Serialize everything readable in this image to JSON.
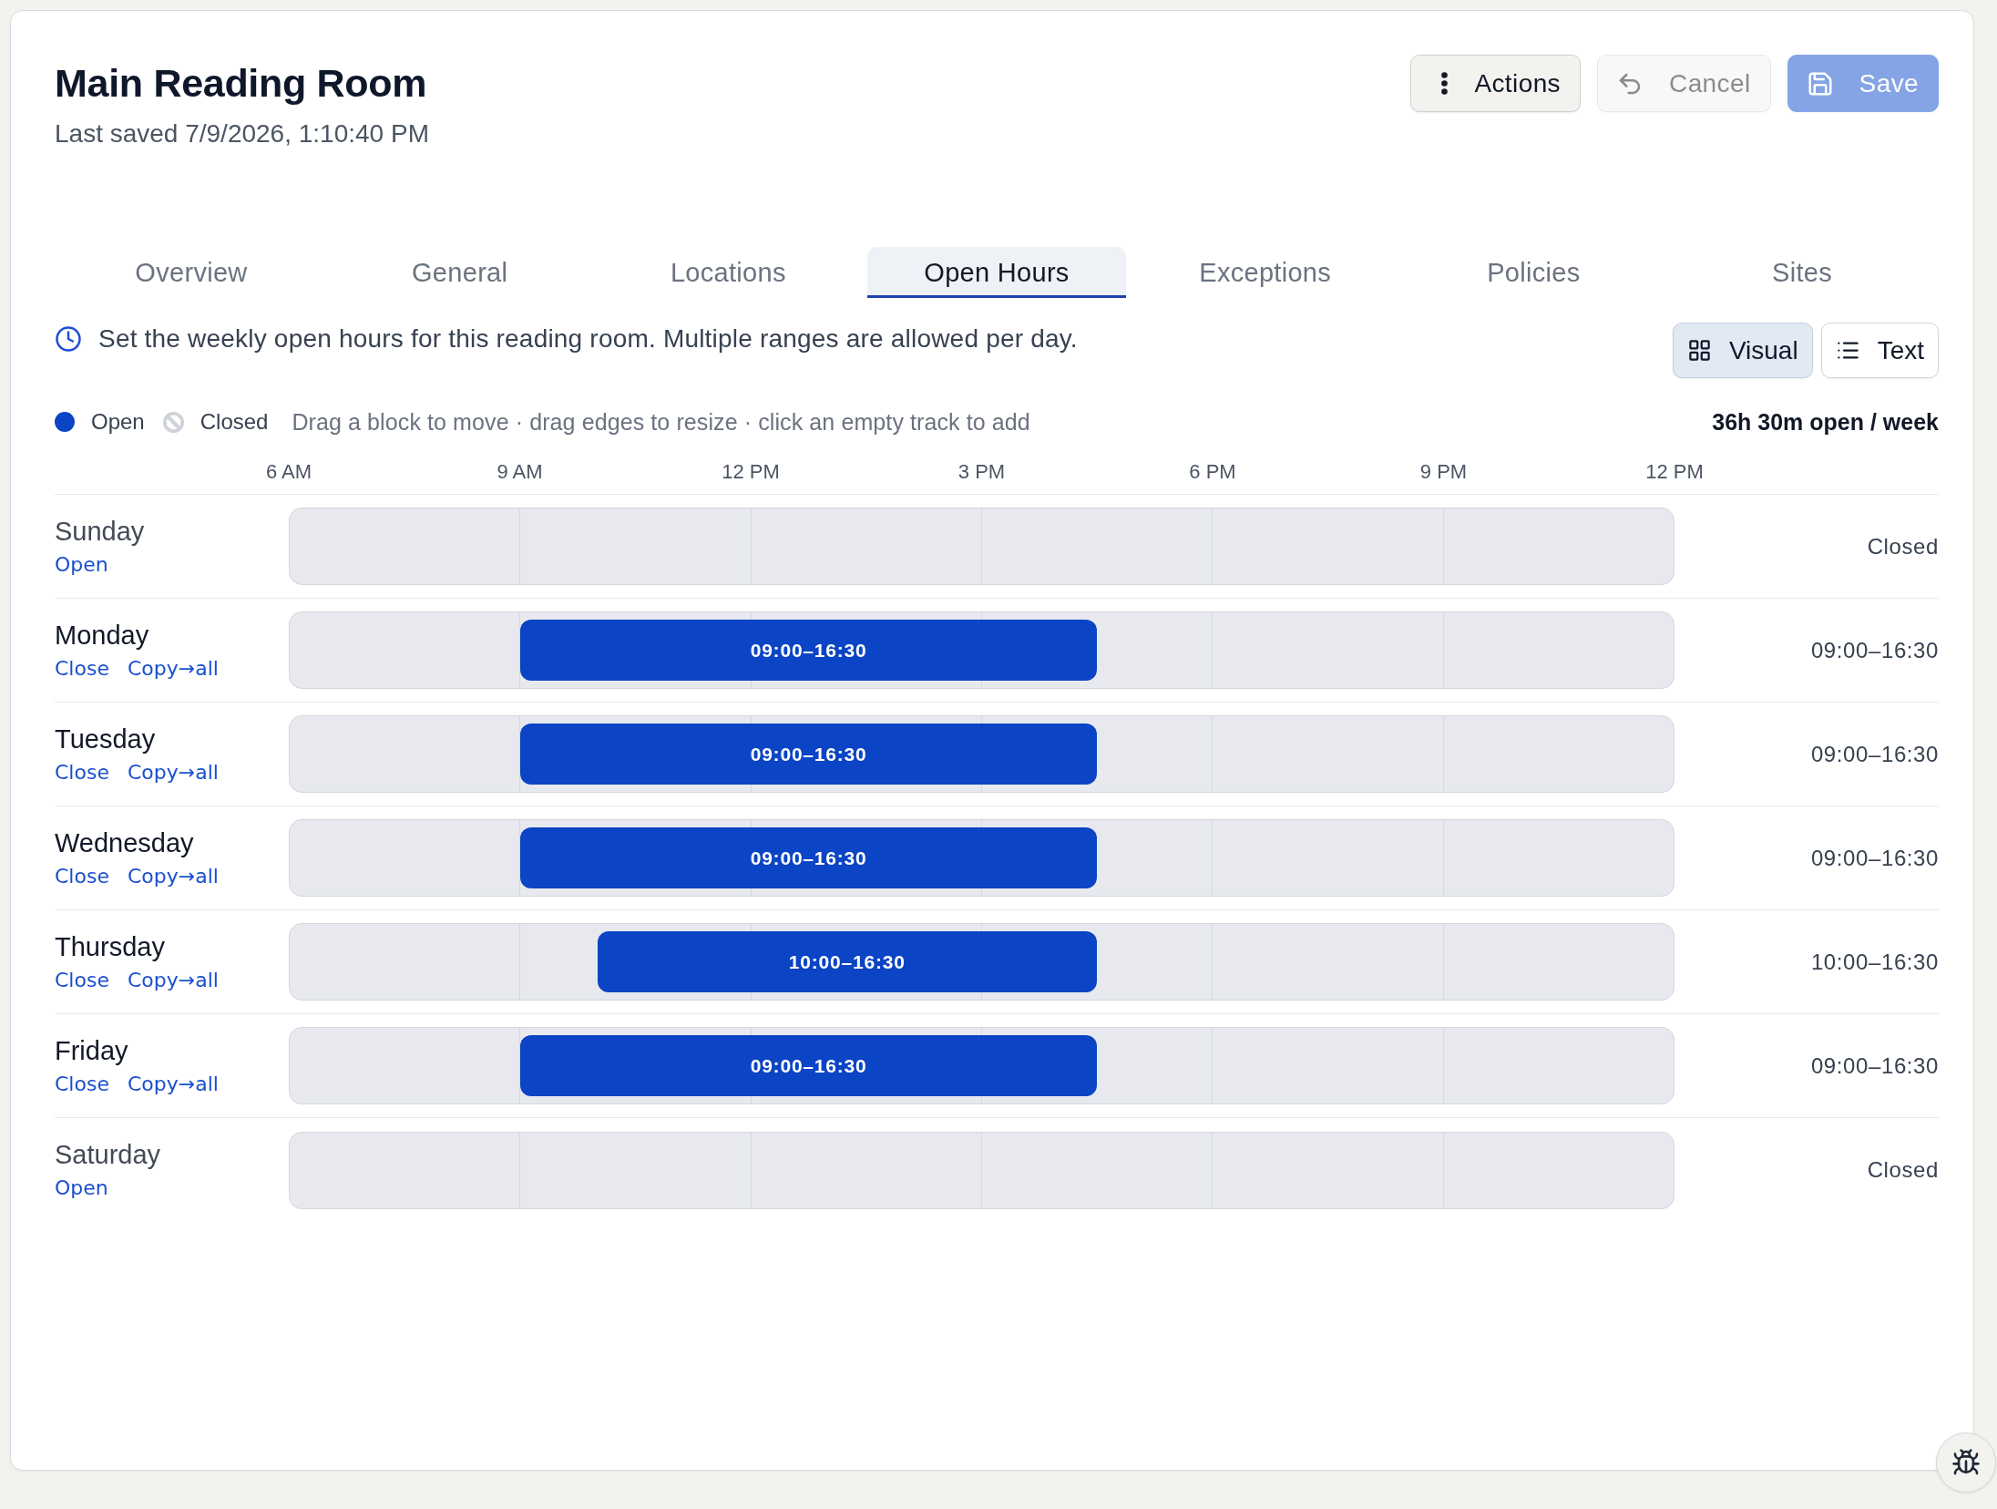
{
  "header": {
    "title": "Main Reading Room",
    "subtitle": "Last saved 7/9/2026, 1:10:40 PM",
    "buttons": [
      {
        "label": "Actions",
        "kind": "menu",
        "primary": false,
        "disabled": false
      },
      {
        "label": "Cancel",
        "kind": "undo",
        "primary": false,
        "disabled": true
      },
      {
        "label": "Save",
        "kind": "save",
        "primary": true,
        "disabled": true
      }
    ]
  },
  "tabs": [
    {
      "label": "Overview",
      "selected": false
    },
    {
      "label": "General",
      "selected": false
    },
    {
      "label": "Locations",
      "selected": false
    },
    {
      "label": "Open Hours",
      "selected": true
    },
    {
      "label": "Exceptions",
      "selected": false
    },
    {
      "label": "Policies",
      "selected": false
    },
    {
      "label": "Sites",
      "selected": false
    }
  ],
  "info": {
    "text": "Set the weekly open hours for this reading room. Multiple ranges are allowed per day."
  },
  "view_toggle": [
    {
      "label": "Visual",
      "kind": "grid",
      "selected": true
    },
    {
      "label": "Text",
      "kind": "list",
      "selected": false
    }
  ],
  "legend": {
    "items": [
      {
        "kind": "open",
        "label": "Open"
      },
      {
        "kind": "closed",
        "label": "Closed"
      }
    ],
    "hint": "Drag a block to move · drag edges to resize · click an empty track to add",
    "total": "36h 30m open / week"
  },
  "axis": {
    "labels": [
      "6 AM",
      "9 AM",
      "12 PM",
      "3 PM",
      "6 PM",
      "9 PM",
      "12 PM"
    ]
  },
  "days": [
    {
      "name": "Sunday",
      "open": false,
      "actions": [
        "Open"
      ],
      "summary": "Closed"
    },
    {
      "name": "Monday",
      "open": true,
      "actions": [
        "Close",
        "Copy→all"
      ],
      "blocks": [
        {
          "label": "09:00–16:30"
        }
      ],
      "summary": "09:00–16:30"
    },
    {
      "name": "Tuesday",
      "open": true,
      "actions": [
        "Close",
        "Copy→all"
      ],
      "blocks": [
        {
          "label": "09:00–16:30"
        }
      ],
      "summary": "09:00–16:30"
    },
    {
      "name": "Wednesday",
      "open": true,
      "actions": [
        "Close",
        "Copy→all"
      ],
      "blocks": [
        {
          "label": "09:00–16:30"
        }
      ],
      "summary": "09:00–16:30"
    },
    {
      "name": "Thursday",
      "open": true,
      "actions": [
        "Close",
        "Copy→all"
      ],
      "blocks": [
        {
          "label": "10:00–16:30"
        }
      ],
      "summary": "10:00–16:30"
    },
    {
      "name": "Friday",
      "open": true,
      "actions": [
        "Close",
        "Copy→all"
      ],
      "blocks": [
        {
          "label": "09:00–16:30"
        }
      ],
      "summary": "09:00–16:30"
    },
    {
      "name": "Saturday",
      "open": false,
      "actions": [
        "Open"
      ],
      "summary": "Closed"
    }
  ]
}
